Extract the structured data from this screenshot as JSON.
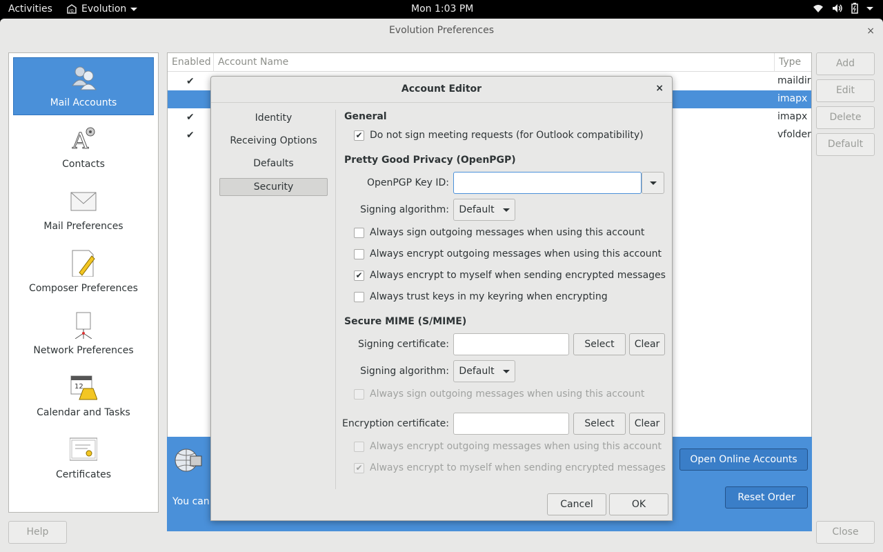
{
  "topbar": {
    "activities": "Activities",
    "app_name": "Evolution",
    "clock": "Mon  1:03 PM"
  },
  "prefs": {
    "title": "Evolution Preferences",
    "close": "×",
    "sidebar": [
      {
        "label": "Mail Accounts",
        "icon": "mail-accounts-icon"
      },
      {
        "label": "Contacts",
        "icon": "contacts-icon"
      },
      {
        "label": "Mail Preferences",
        "icon": "envelope-icon"
      },
      {
        "label": "Composer Preferences",
        "icon": "composer-icon"
      },
      {
        "label": "Network Preferences",
        "icon": "network-icon"
      },
      {
        "label": "Calendar and Tasks",
        "icon": "calendar-icon"
      },
      {
        "label": "Certificates",
        "icon": "certificate-icon"
      }
    ],
    "table": {
      "col_enabled": "Enabled",
      "col_name": "Account Name",
      "col_type": "Type",
      "rows": [
        {
          "checked": "✔",
          "type": "maildir"
        },
        {
          "checked": "",
          "type": "imapx"
        },
        {
          "checked": "✔",
          "type": "imapx"
        },
        {
          "checked": "✔",
          "type": "vfolder"
        }
      ]
    },
    "info_text": "You can",
    "open_online_accounts": "Open Online Accounts",
    "reset_order": "Reset Order",
    "buttons": {
      "add": "Add",
      "edit": "Edit",
      "delete": "Delete",
      "default": "Default"
    },
    "help": "Help",
    "close_btn": "Close"
  },
  "dialog": {
    "title": "Account Editor",
    "close": "×",
    "nav": [
      "Identity",
      "Receiving Options",
      "Defaults",
      "Security"
    ],
    "general": {
      "title": "General",
      "meeting": "Do not sign meeting requests (for Outlook compatibility)"
    },
    "pgp": {
      "title": "Pretty Good Privacy (OpenPGP)",
      "key_label": "OpenPGP Key ID:",
      "key_value": "",
      "alg_label": "Signing algorithm:",
      "alg_value": "Default",
      "opt1": "Always sign outgoing messages when using this account",
      "opt2": "Always encrypt outgoing messages when using this account",
      "opt3": "Always encrypt to myself when sending encrypted messages",
      "opt4": "Always trust keys in my keyring when encrypting"
    },
    "smime": {
      "title": "Secure MIME (S/MIME)",
      "sign_cert_label": "Signing certificate:",
      "alg_label": "Signing algorithm:",
      "alg_value": "Default",
      "sign_opt": "Always sign outgoing messages when using this account",
      "enc_cert_label": "Encryption certificate:",
      "enc_opt1": "Always encrypt outgoing messages when using this account",
      "enc_opt2": "Always encrypt to myself when sending encrypted messages",
      "select": "Select",
      "clear": "Clear"
    },
    "check": "✔",
    "cancel": "Cancel",
    "ok": "OK"
  }
}
